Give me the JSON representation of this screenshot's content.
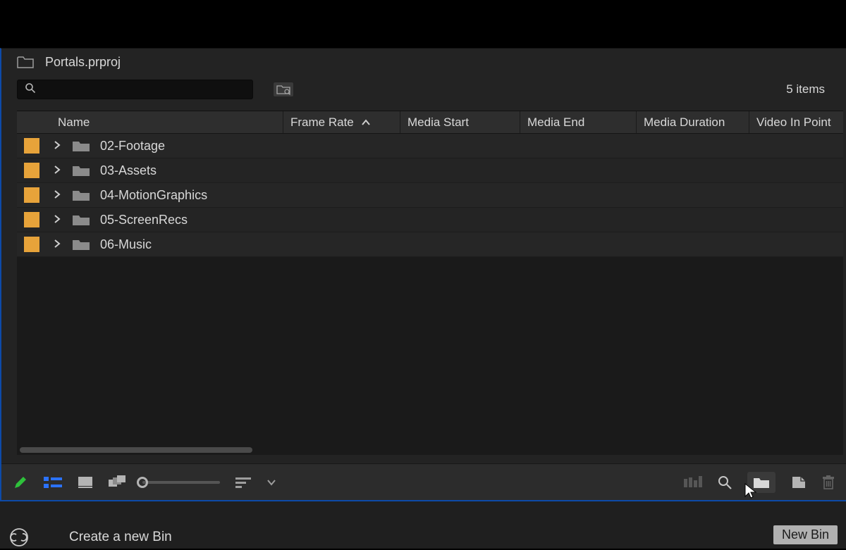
{
  "project": {
    "title": "Portals.prproj"
  },
  "search": {
    "placeholder": "",
    "value": ""
  },
  "itemCount": "5 items",
  "columns": {
    "name": "Name",
    "frameRate": "Frame Rate",
    "mediaStart": "Media Start",
    "mediaEnd": "Media End",
    "mediaDuration": "Media Duration",
    "videoInPoint": "Video In Point"
  },
  "rows": [
    {
      "name": "02-Footage"
    },
    {
      "name": "03-Assets"
    },
    {
      "name": "04-MotionGraphics"
    },
    {
      "name": "05-ScreenRecs"
    },
    {
      "name": "06-Music"
    }
  ],
  "status": {
    "hint": "Create a new Bin",
    "tooltip": "New Bin"
  }
}
